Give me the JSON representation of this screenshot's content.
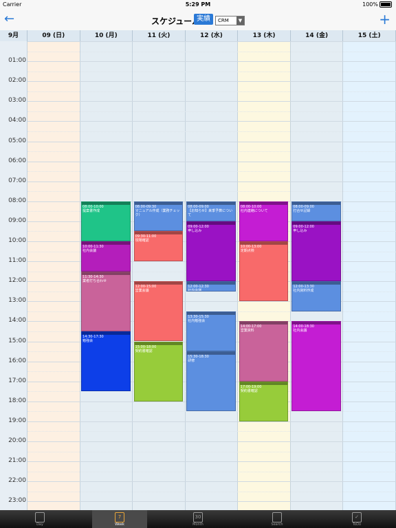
{
  "status_bar": {
    "carrier": "Carrier",
    "time": "5:29 PM",
    "battery": "100%"
  },
  "nav": {
    "back_icon": "arrow-left-icon",
    "title": "スケジュール",
    "actual_button": "実績",
    "crm_value": "CRM",
    "add_icon": "plus-icon"
  },
  "week": {
    "month_label": "9月",
    "days": [
      {
        "label": "09 (日)",
        "bg": "#fdf0e2"
      },
      {
        "label": "10 (月)",
        "bg": "#e4edf3"
      },
      {
        "label": "11 (火)",
        "bg": "#e4edf3"
      },
      {
        "label": "12 (水)",
        "bg": "#e4edf3"
      },
      {
        "label": "13 (木)",
        "bg": "#fdf8e0"
      },
      {
        "label": "14 (金)",
        "bg": "#e4edf3"
      },
      {
        "label": "15 (土)",
        "bg": "#e3f2fd"
      }
    ]
  },
  "time_labels": [
    "01:00",
    "02:00",
    "03:00",
    "04:00",
    "05:00",
    "06:00",
    "07:00",
    "08:00",
    "09:00",
    "10:00",
    "11:00",
    "12:00",
    "13:00",
    "14:00",
    "15:00",
    "16:00",
    "17:00",
    "18:00",
    "19:00",
    "20:00",
    "21:00",
    "22:00",
    "23:00"
  ],
  "events": [
    {
      "day": 1,
      "start": 8.0,
      "end": 10.0,
      "time": "08:00-10:00",
      "title": "提案書作成",
      "color": "#1fc488"
    },
    {
      "day": 1,
      "start": 10.0,
      "end": 11.5,
      "time": "10:00-11:30",
      "title": "社内会議",
      "color": "#b41ebb"
    },
    {
      "day": 1,
      "start": 11.5,
      "end": 14.5,
      "time": "11:30-14:30",
      "title": "業者打ち合わせ",
      "color": "#c9639a"
    },
    {
      "day": 1,
      "start": 14.5,
      "end": 17.5,
      "time": "14:30-17:30",
      "title": "勉強会",
      "color": "#0d3fe8"
    },
    {
      "day": 2,
      "start": 8.0,
      "end": 9.5,
      "time": "08:00-09:30",
      "title": "マニュアル作成（業務チェック）",
      "color": "#5c8fe0"
    },
    {
      "day": 2,
      "start": 9.5,
      "end": 11.0,
      "time": "09:30-11:00",
      "title": "現場確認",
      "color": "#f86a6a"
    },
    {
      "day": 2,
      "start": 12.0,
      "end": 15.0,
      "time": "12:00-15:00",
      "title": "営業会議",
      "color": "#f86a6a"
    },
    {
      "day": 2,
      "start": 15.0,
      "end": 18.0,
      "time": "15:00-18:00",
      "title": "契約書確認",
      "color": "#97cc3a"
    },
    {
      "day": 3,
      "start": 8.0,
      "end": 9.0,
      "time": "08:00-09:00",
      "title": "【お知らせ】来季予算について",
      "color": "#5c8fe0"
    },
    {
      "day": 3,
      "start": 9.0,
      "end": 12.0,
      "time": "09:00-12:00",
      "title": "申し込み",
      "color": "#9a12c4"
    },
    {
      "day": 3,
      "start": 12.0,
      "end": 12.5,
      "time": "12:00-12:30",
      "title": "社内会議",
      "color": "#5c8fe0"
    },
    {
      "day": 3,
      "start": 13.5,
      "end": 15.5,
      "time": "13:30-15:30",
      "title": "社内勉強会",
      "color": "#5c8fe0"
    },
    {
      "day": 3,
      "start": 15.5,
      "end": 18.5,
      "time": "15:30-18:30",
      "title": "研修",
      "color": "#5c8fe0"
    },
    {
      "day": 4,
      "start": 8.0,
      "end": 10.0,
      "time": "08:00-10:00",
      "title": "社内連絡について",
      "color": "#c41dd3"
    },
    {
      "day": 4,
      "start": 10.0,
      "end": 13.0,
      "time": "10:00-13:00",
      "title": "定期点検",
      "color": "#f86a6a"
    },
    {
      "day": 4,
      "start": 14.0,
      "end": 17.0,
      "time": "14:00-17:00",
      "title": "営業資料",
      "color": "#c9639a"
    },
    {
      "day": 4,
      "start": 17.0,
      "end": 19.0,
      "time": "17:00-19:00",
      "title": "契約書確認",
      "color": "#97cc3a"
    },
    {
      "day": 5,
      "start": 8.0,
      "end": 9.0,
      "time": "08:00-09:00",
      "title": "打合せ記録",
      "color": "#5c8fe0"
    },
    {
      "day": 5,
      "start": 9.0,
      "end": 12.0,
      "time": "09:00-12:00",
      "title": "申し込み",
      "color": "#9a12c4"
    },
    {
      "day": 5,
      "start": 12.0,
      "end": 13.5,
      "time": "12:00-13:30",
      "title": "社内資料作成",
      "color": "#5c8fe0"
    },
    {
      "day": 5,
      "start": 14.0,
      "end": 18.5,
      "time": "14:00-18:30",
      "title": "社内会議",
      "color": "#c41dd3"
    }
  ],
  "tabs": [
    {
      "label": "Day",
      "icon": "day-calendar-icon",
      "glyph": "",
      "active": false
    },
    {
      "label": "Week",
      "icon": "week-calendar-icon",
      "glyph": "7",
      "active": true
    },
    {
      "label": "Month",
      "icon": "month-calendar-icon",
      "glyph": "30",
      "active": false
    },
    {
      "label": "Search",
      "icon": "search-icon",
      "glyph": "",
      "active": false
    },
    {
      "label": "ToDo",
      "icon": "todo-check-icon",
      "glyph": "✓",
      "active": false
    }
  ]
}
